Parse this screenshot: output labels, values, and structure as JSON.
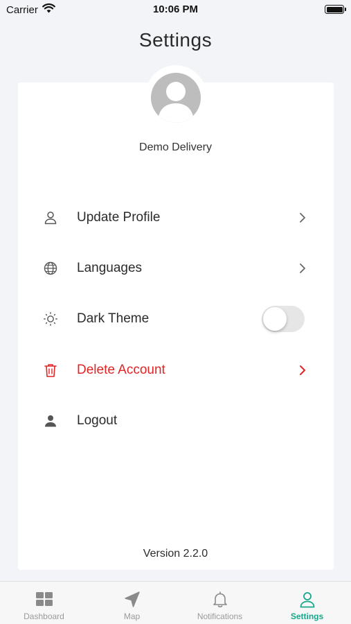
{
  "status_bar": {
    "carrier": "Carrier",
    "time": "10:06 PM"
  },
  "page": {
    "title": "Settings"
  },
  "profile": {
    "name": "Demo Delivery",
    "avatar_icon": "user-silhouette-icon"
  },
  "menu": {
    "update_profile": {
      "label": "Update Profile",
      "icon": "person-outline-icon"
    },
    "languages": {
      "label": "Languages",
      "icon": "globe-icon"
    },
    "dark_theme": {
      "label": "Dark Theme",
      "icon": "sun-icon",
      "enabled": false
    },
    "delete_account": {
      "label": "Delete Account",
      "icon": "trash-icon",
      "color": "#e02424"
    },
    "logout": {
      "label": "Logout",
      "icon": "person-filled-icon"
    }
  },
  "version": "Version 2.2.0",
  "tabs": [
    {
      "label": "Dashboard",
      "icon": "dashboard-grid-icon",
      "active": false
    },
    {
      "label": "Map",
      "icon": "navigation-arrow-icon",
      "active": false
    },
    {
      "label": "Notifications",
      "icon": "bell-icon",
      "active": false
    },
    {
      "label": "Settings",
      "icon": "person-outline-icon",
      "active": true
    }
  ],
  "colors": {
    "accent": "#16a88a",
    "danger": "#e02424",
    "background": "#f2f4f7",
    "card": "#ffffff"
  }
}
